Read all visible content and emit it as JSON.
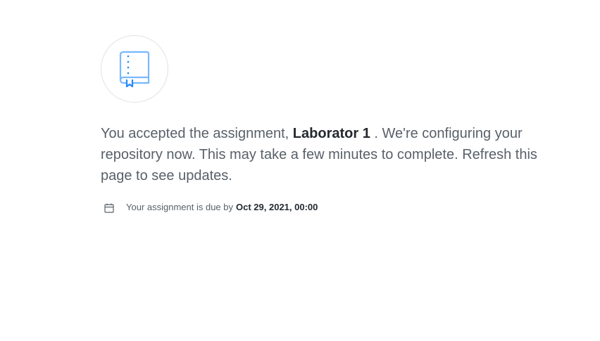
{
  "status_icon": "repo-book-icon",
  "message": {
    "prefix": "You accepted the assignment,",
    "assignment_name": "Laborator 1",
    "suffix": ". We're configuring your repository now. This may take a few minutes to complete. Refresh this page to see updates."
  },
  "due": {
    "icon": "calendar-icon",
    "label": "Your assignment is due by",
    "date": "Oct 29, 2021, 00:00"
  },
  "colors": {
    "icon_blue": "#79b8ff",
    "text_muted": "#586069",
    "text_strong": "#24292e"
  }
}
